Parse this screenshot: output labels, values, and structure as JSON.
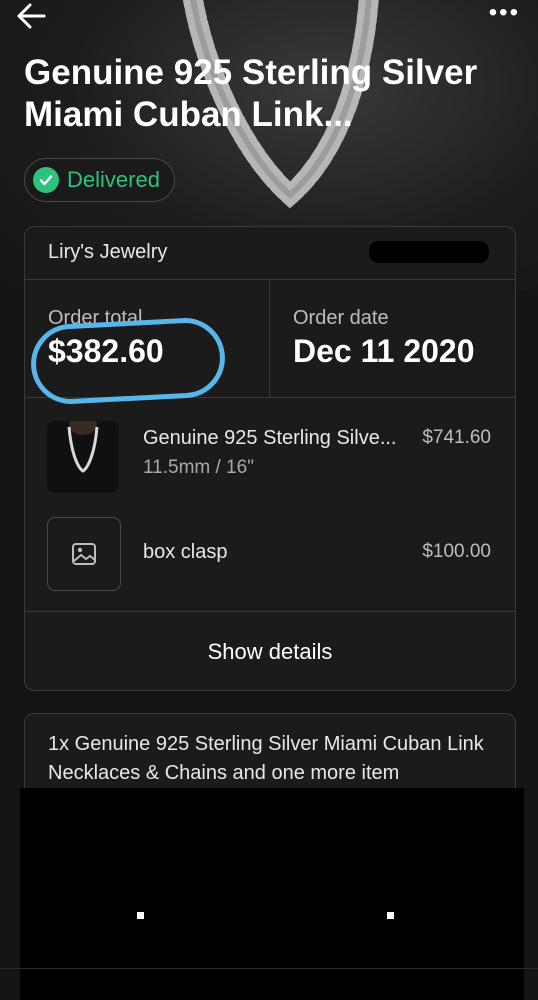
{
  "header": {
    "title": "Genuine 925 Sterling Silver Miami Cuban Link...",
    "status": "Delivered",
    "back_icon": "arrow-left-icon",
    "more_icon": "more-horizontal-icon"
  },
  "order": {
    "store": "Liry's Jewelry",
    "total_label": "Order total",
    "total_value": "$382.60",
    "date_label": "Order date",
    "date_value": "Dec 11 2020"
  },
  "items": [
    {
      "name": "Genuine 925 Sterling Silve...",
      "variant": "11.5mm / 16\"",
      "price": "$741.60"
    },
    {
      "name": "box clasp",
      "price": "$100.00"
    }
  ],
  "show_details": "Show details",
  "summary": "1x Genuine 925 Sterling Silver Miami Cuban Link Necklaces & Chains and one more item",
  "colors": {
    "background": "#141414",
    "delivered": "#2ec27e",
    "annotation": "#58b7ea"
  }
}
